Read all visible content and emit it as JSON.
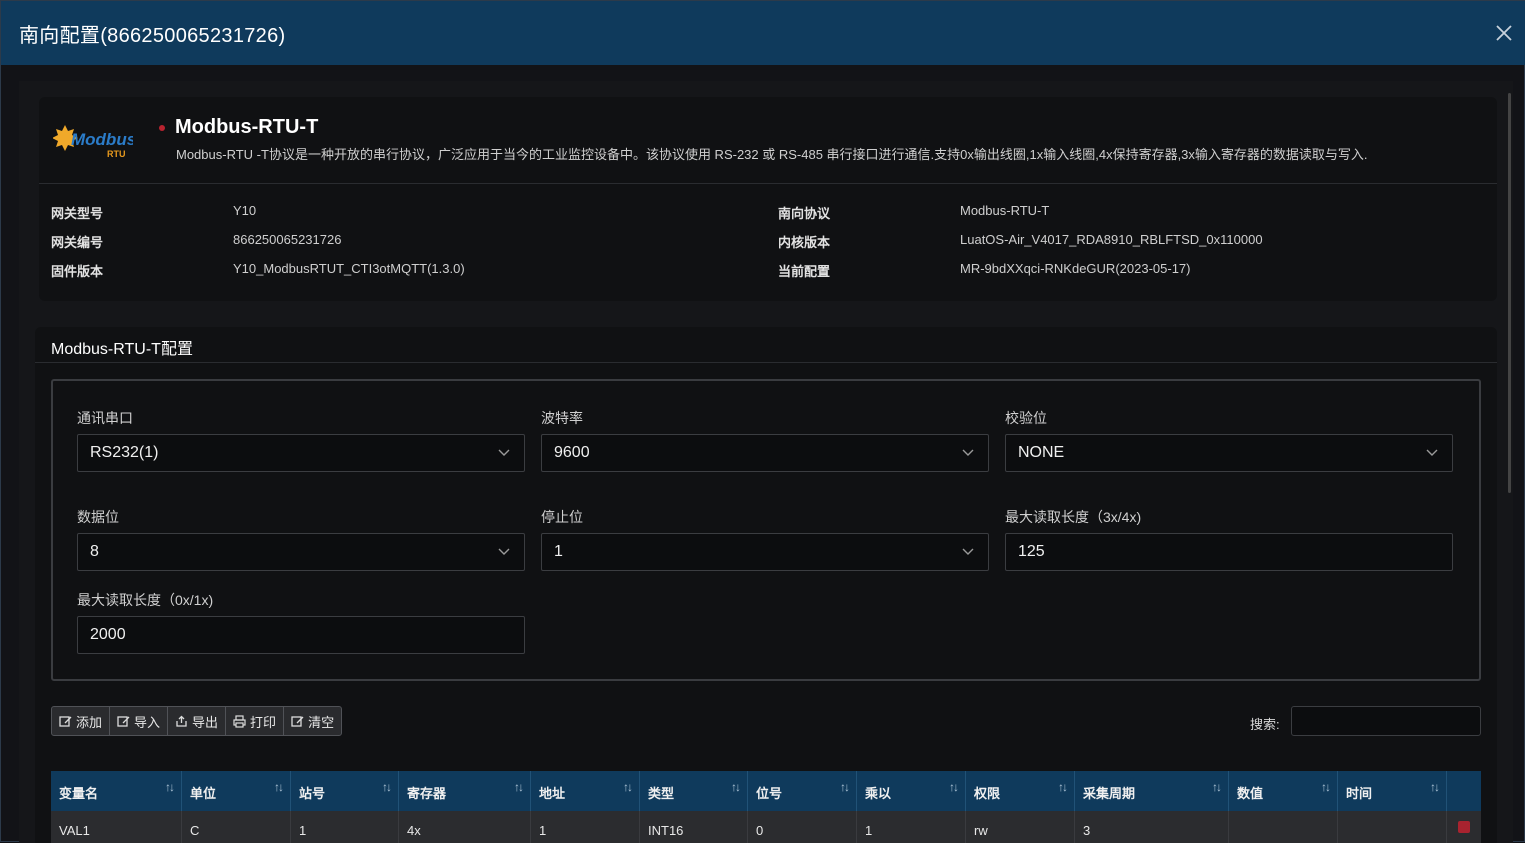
{
  "window": {
    "title": "南向配置(866250065231726)"
  },
  "protocol": {
    "logo_text": "Modbus",
    "logo_sub": "RTU",
    "name": "Modbus-RTU-T",
    "description": "Modbus-RTU -T协议是一种开放的串行协议，广泛应用于当今的工业监控设备中。该协议使用 RS-232 或 RS-485 串行接口进行通信.支持0x输出线圈,1x输入线圈,4x保持寄存器,3x输入寄存器的数据读取与写入."
  },
  "info": {
    "gateway_model_label": "网关型号",
    "gateway_model": "Y10",
    "gateway_id_label": "网关编号",
    "gateway_id": "866250065231726",
    "firmware_label": "固件版本",
    "firmware": "Y10_ModbusRTUT_CTI3otMQTT(1.3.0)",
    "south_protocol_label": "南向协议",
    "south_protocol": "Modbus-RTU-T",
    "kernel_label": "内核版本",
    "kernel": "LuatOS-Air_V4017_RDA8910_RBLFTSD_0x110000",
    "current_config_label": "当前配置",
    "current_config": "MR-9bdXXqci-RNKdeGUR(2023-05-17)"
  },
  "config": {
    "header": "Modbus-RTU-T配置",
    "serial_label": "通讯串口",
    "serial_value": "RS232(1)",
    "baud_label": "波特率",
    "baud_value": "9600",
    "parity_label": "校验位",
    "parity_value": "NONE",
    "databits_label": "数据位",
    "databits_value": "8",
    "stopbits_label": "停止位",
    "stopbits_value": "1",
    "maxlen34_label": "最大读取长度（3x/4x)",
    "maxlen34_value": "125",
    "maxlen01_label": "最大读取长度（0x/1x)",
    "maxlen01_value": "2000"
  },
  "toolbar": {
    "add": "添加",
    "import": "导入",
    "export": "导出",
    "print": "打印",
    "clear": "清空",
    "search_label": "搜索:"
  },
  "table": {
    "columns": [
      "变量名",
      "单位",
      "站号",
      "寄存器",
      "地址",
      "类型",
      "位号",
      "乘以",
      "权限",
      "采集周期",
      "数值",
      "时间"
    ],
    "rows": [
      [
        "VAL1",
        "C",
        "1",
        "4x",
        "1",
        "INT16",
        "0",
        "1",
        "rw",
        "3",
        "",
        ""
      ]
    ]
  },
  "colors": {
    "titlebar": "#0f3a5c",
    "table_header": "#0f3a5c",
    "accent_red": "#a8232f"
  }
}
